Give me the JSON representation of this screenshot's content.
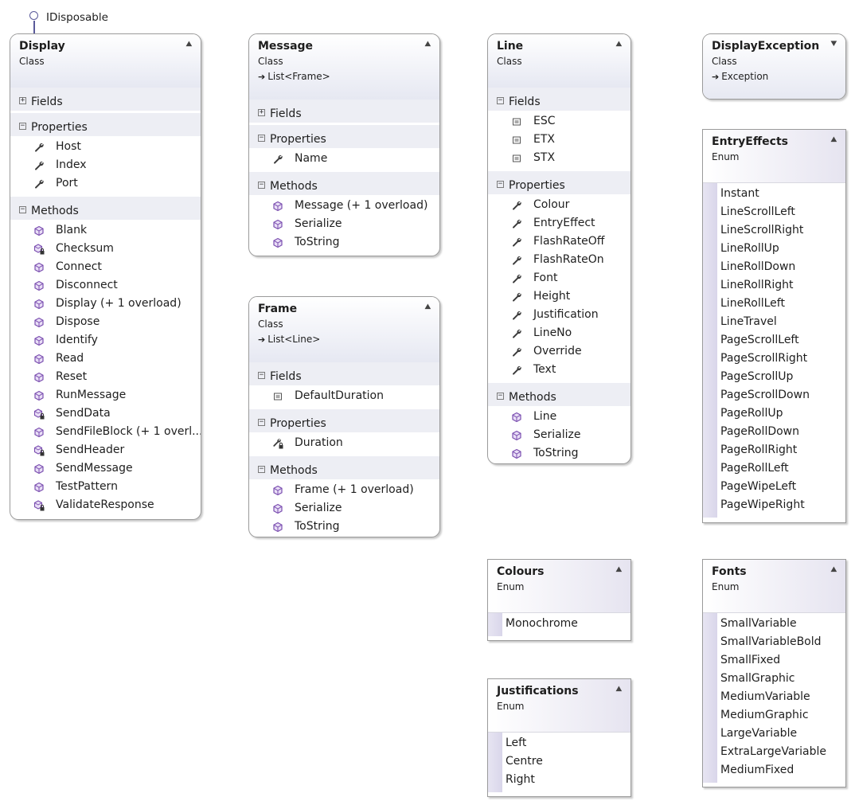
{
  "interface_label": "IDisposable",
  "enum_kind": "Enum",
  "class_kind": "Class",
  "classes": {
    "display": {
      "name": "Display",
      "kind": "Class",
      "fields_label": "Fields",
      "properties_label": "Properties",
      "properties": [
        "Host",
        "Index",
        "Port"
      ],
      "methods_label": "Methods",
      "methods": [
        "Blank",
        "Checksum",
        "Connect",
        "Disconnect",
        "Display (+ 1 overload)",
        "Dispose",
        "Identify",
        "Read",
        "Reset",
        "RunMessage",
        "SendData",
        "SendFileBlock (+ 1 overl...",
        "SendHeader",
        "SendMessage",
        "TestPattern",
        "ValidateResponse"
      ]
    },
    "message": {
      "name": "Message",
      "kind": "Class",
      "base": "List<Frame>",
      "fields_label": "Fields",
      "properties_label": "Properties",
      "properties": [
        "Name"
      ],
      "methods_label": "Methods",
      "methods": [
        "Message (+ 1 overload)",
        "Serialize",
        "ToString"
      ]
    },
    "frame": {
      "name": "Frame",
      "kind": "Class",
      "base": "List<Line>",
      "fields_label": "Fields",
      "fields": [
        "DefaultDuration"
      ],
      "properties_label": "Properties",
      "properties": [
        "Duration"
      ],
      "methods_label": "Methods",
      "methods": [
        "Frame (+ 1 overload)",
        "Serialize",
        "ToString"
      ]
    },
    "line": {
      "name": "Line",
      "kind": "Class",
      "fields_label": "Fields",
      "fields": [
        "ESC",
        "ETX",
        "STX"
      ],
      "properties_label": "Properties",
      "properties": [
        "Colour",
        "EntryEffect",
        "FlashRateOff",
        "FlashRateOn",
        "Font",
        "Height",
        "Justification",
        "LineNo",
        "Override",
        "Text"
      ],
      "methods_label": "Methods",
      "methods": [
        "Line",
        "Serialize",
        "ToString"
      ]
    },
    "display_exception": {
      "name": "DisplayException",
      "kind": "Class",
      "base": "Exception"
    }
  },
  "enums": {
    "entry_effects": {
      "name": "EntryEffects",
      "kind": "Enum",
      "values": [
        "Instant",
        "LineScrollLeft",
        "LineScrollRight",
        "LineRollUp",
        "LineRollDown",
        "LineRollRight",
        "LineRollLeft",
        "LineTravel",
        "PageScrollLeft",
        "PageScrollRight",
        "PageScrollUp",
        "PageScrollDown",
        "PageRollUp",
        "PageRollDown",
        "PageRollRight",
        "PageRollLeft",
        "PageWipeLeft",
        "PageWipeRight"
      ]
    },
    "colours": {
      "name": "Colours",
      "kind": "Enum",
      "values": [
        "Monochrome"
      ]
    },
    "justifications": {
      "name": "Justifications",
      "kind": "Enum",
      "values": [
        "Left",
        "Centre",
        "Right"
      ]
    },
    "fonts": {
      "name": "Fonts",
      "kind": "Enum",
      "values": [
        "SmallVariable",
        "SmallVariableBold",
        "SmallFixed",
        "SmallGraphic",
        "MediumVariable",
        "MediumGraphic",
        "LargeVariable",
        "ExtraLargeVariable",
        "MediumFixed"
      ]
    }
  },
  "icons": {
    "method_public": "method-cube-icon",
    "method_private": "private-method-cube-icon",
    "property": "wrench-icon",
    "property_private": "private-wrench-icon",
    "field": "field-icon"
  },
  "colors": {
    "header_gradient_end": "#e6e8f2",
    "section_bg": "#edeef4",
    "method_icon": "#7b4fb0",
    "enum_bar": "#d9d6ea"
  }
}
